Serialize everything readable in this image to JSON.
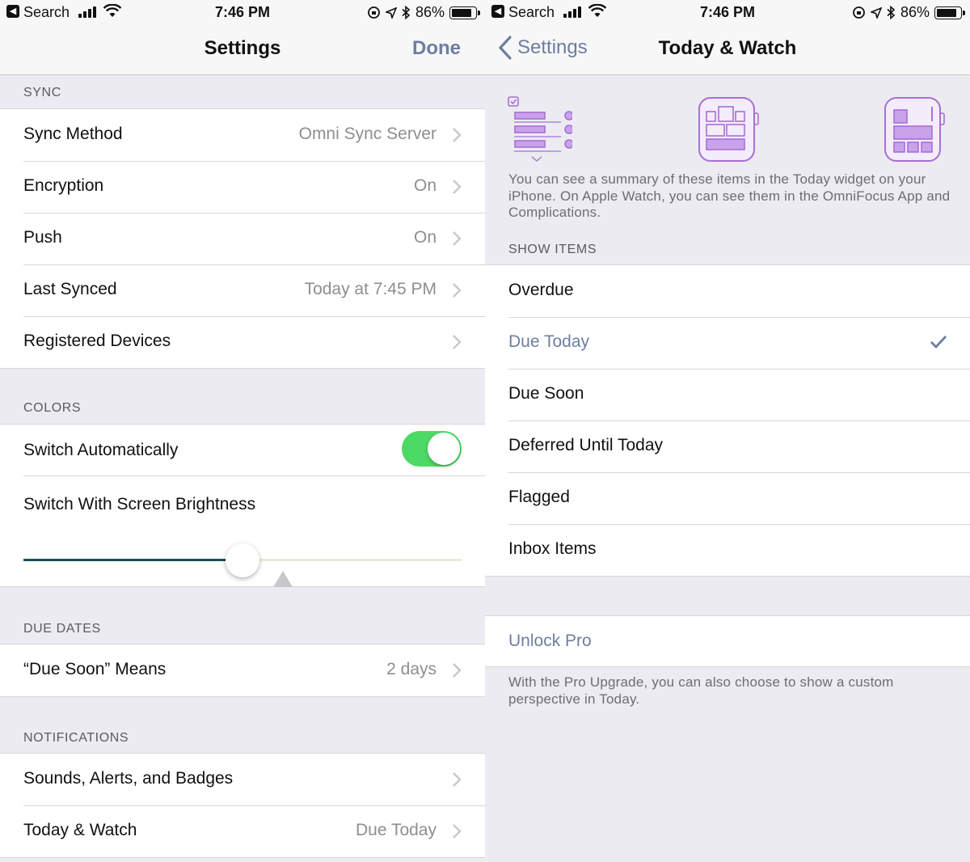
{
  "status_bar": {
    "back_app": "Search",
    "time": "7:46 PM",
    "battery": "86%"
  },
  "left": {
    "nav": {
      "title": "Settings",
      "done_label": "Done"
    },
    "sync": {
      "header": "SYNC",
      "rows": [
        {
          "label": "Sync Method",
          "value": "Omni Sync Server"
        },
        {
          "label": "Encryption",
          "value": "On"
        },
        {
          "label": "Push",
          "value": "On"
        },
        {
          "label": "Last Synced",
          "value": "Today at 7:45 PM"
        },
        {
          "label": "Registered Devices",
          "value": ""
        }
      ]
    },
    "colors": {
      "header": "COLORS",
      "switch_auto_label": "Switch Automatically",
      "switch_auto_on": true,
      "brightness_label": "Switch With Screen Brightness",
      "brightness_level": 0.5
    },
    "due_dates": {
      "header": "DUE DATES",
      "rows": [
        {
          "label": "“Due Soon” Means",
          "value": "2 days"
        }
      ]
    },
    "notifications": {
      "header": "NOTIFICATIONS",
      "rows": [
        {
          "label": "Sounds, Alerts, and Badges",
          "value": ""
        },
        {
          "label": "Today & Watch",
          "value": "Due Today"
        }
      ]
    }
  },
  "right": {
    "nav": {
      "back_label": "Settings",
      "title": "Today & Watch"
    },
    "intro": "You can see a summary of these items in the Today widget on your iPhone. On Apple Watch, you can see them in the OmniFocus App and Complications.",
    "show_items": {
      "header": "SHOW ITEMS",
      "items": [
        {
          "label": "Overdue",
          "selected": false
        },
        {
          "label": "Due Today",
          "selected": true
        },
        {
          "label": "Due Soon",
          "selected": false
        },
        {
          "label": "Deferred Until Today",
          "selected": false
        },
        {
          "label": "Flagged",
          "selected": false
        },
        {
          "label": "Inbox Items",
          "selected": false
        }
      ]
    },
    "unlock_label": "Unlock Pro",
    "footer": "With the Pro Upgrade, you can also choose to show a custom perspective in Today."
  },
  "colors": {
    "accent": "#6d7ea0",
    "toggle_on": "#4cd964",
    "illustration": "#a86fd6"
  },
  "icons": [
    "chevron-right-icon",
    "checkmark-icon",
    "back-chevron-icon",
    "today-widget-icon",
    "watch-app-icon",
    "watch-complication-icon"
  ]
}
